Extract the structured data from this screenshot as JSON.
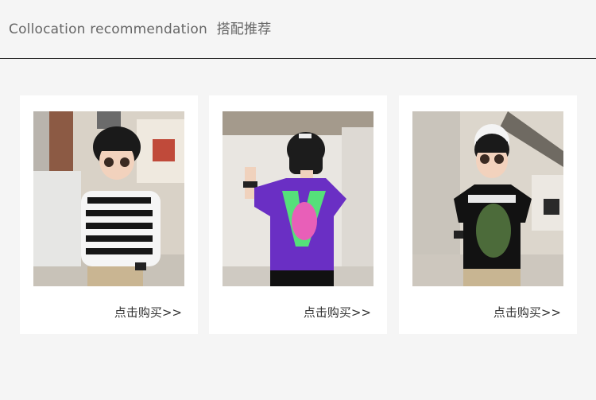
{
  "header": {
    "title_en": "Collocation recommendation",
    "title_zh": "搭配推荐"
  },
  "products": [
    {
      "buy_label": "点击购买>>",
      "image": "striped-vest-outfit"
    },
    {
      "buy_label": "点击购买>>",
      "image": "purple-tee-outfit"
    },
    {
      "buy_label": "点击购买>>",
      "image": "black-tee-outfit"
    }
  ],
  "colors": {
    "background": "#f5f5f5",
    "card": "#ffffff",
    "text_header": "#666666",
    "text_link": "#333333",
    "purple_tee": "#6a2fc4",
    "green_print": "#55e07a"
  }
}
